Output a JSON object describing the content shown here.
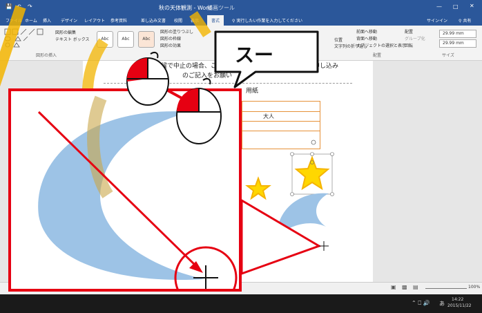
{
  "window": {
    "title": "秋の天体観測 - Word",
    "context_tab_group": "描画ツール",
    "signin": "サインイン",
    "share": "共有"
  },
  "tabs": [
    "ファイル",
    "ホーム",
    "挿入",
    "デザイン",
    "レイアウト",
    "参考資料",
    "差し込み文書",
    "校閲",
    "表示",
    "書式"
  ],
  "tell_me": "実行したい作業を入力してください",
  "ribbon": {
    "edit_shape": "図形の編集",
    "text_box": "テキスト ボックス",
    "group_insert_shapes": "図形の挿入",
    "style_label": "Abc",
    "shape_fill": "図形の塗りつぶし",
    "shape_outline": "図形の枠線",
    "shape_effects": "図形の効果",
    "bring_forward": "前面へ移動",
    "send_backward": "背面へ移動",
    "selection_pane": "オブジェクトの選択と表示",
    "align": "配置",
    "group": "グループ化",
    "rotate": "回転",
    "position": "位置",
    "wrap_text": "文字列の折り返し",
    "group_arrange": "配置",
    "height_value": "29.99 mm",
    "width_value": "29.99 mm",
    "group_size": "サイズ"
  },
  "document": {
    "line1": "天候で中止の場合、こち",
    "line1_tail": "必ず申し込み",
    "line2": "のご記入をお願い",
    "line3_tail": "用紙",
    "table_cell": "大人"
  },
  "callout": {
    "text": "スー"
  },
  "status": {
    "zoom": "100%"
  },
  "taskbar": {
    "time": "14:22",
    "date": "2015/11/22",
    "ime": "あ"
  },
  "colors": {
    "accent_red": "#e60012",
    "word_blue": "#2b579a",
    "moon_fill": "#9dc3e6",
    "star_fill": "#ffd700",
    "watermark": "#f2b400"
  }
}
